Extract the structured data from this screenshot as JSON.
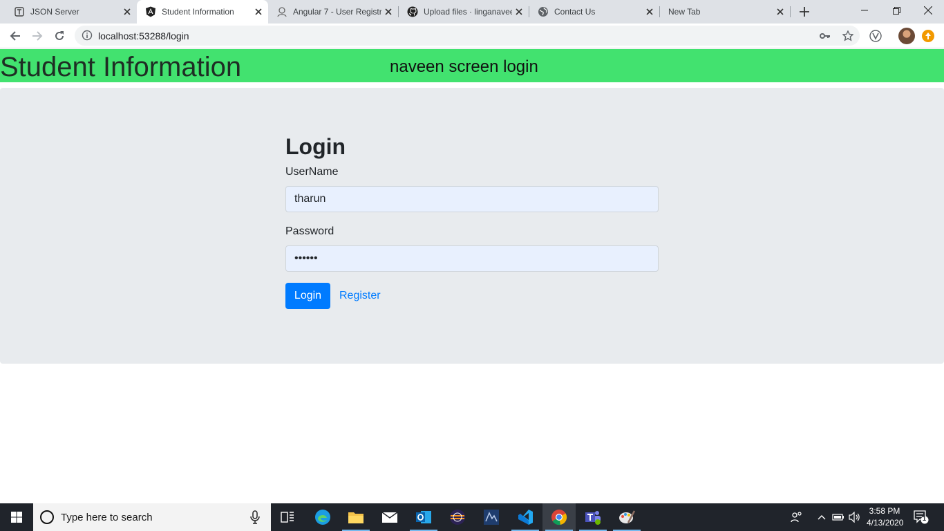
{
  "browser": {
    "tabs": [
      {
        "title": "JSON Server",
        "icon": "json-server-icon",
        "active": false
      },
      {
        "title": "Student Information",
        "icon": "angular-icon",
        "active": true
      },
      {
        "title": "Angular 7 - User Registr",
        "icon": "avatar-icon",
        "active": false
      },
      {
        "title": "Upload files · linganaveen",
        "icon": "github-icon",
        "active": false
      },
      {
        "title": "Contact Us",
        "icon": "globe-icon",
        "active": false
      },
      {
        "title": "New Tab",
        "icon": "",
        "active": false
      }
    ],
    "url": "localhost:53288/login",
    "accent": "#42e26f"
  },
  "header": {
    "title": "Student Information",
    "subtitle": "naveen screen login"
  },
  "login": {
    "heading": "Login",
    "username_label": "UserName",
    "username_value": "tharun",
    "password_label": "Password",
    "password_value": "tharun",
    "login_button": "Login",
    "register_link": "Register"
  },
  "taskbar": {
    "search_placeholder": "Type here to search",
    "apps": [
      "task-view",
      "edge",
      "file-explorer",
      "mail",
      "outlook",
      "eclipse",
      "sql-server",
      "vscode",
      "chrome",
      "teams",
      "paint"
    ],
    "time": "3:58 PM",
    "date": "4/13/2020",
    "notifications": "1"
  }
}
